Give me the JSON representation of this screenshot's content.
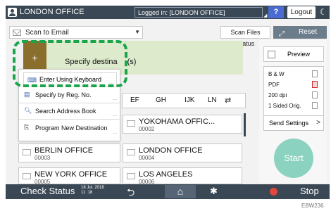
{
  "topbar": {
    "title": "LONDON OFFICE",
    "login_status": "Logged in: [LONDON OFFICE]",
    "help_label": "?",
    "logout_label": "Logout"
  },
  "toolbar": {
    "mode_label": "Scan to Email",
    "scan_files_status_label": "Scan Files Status",
    "reset_label": "Reset"
  },
  "destination": {
    "plus_label": "+",
    "specify_label": "Specify destina",
    "specify_suffix": "(s)"
  },
  "popup": {
    "items": [
      {
        "label": "Enter Using Keyboard",
        "icon": "keyboard-icon"
      },
      {
        "label": "Specify by Reg. No.",
        "icon": "number-icon"
      },
      {
        "label": "Search Address Book",
        "icon": "search-icon"
      },
      {
        "label": "Program New Destination",
        "icon": "program-icon"
      }
    ],
    "more": "..."
  },
  "tabs": [
    "EF",
    "GH",
    "IJK",
    "LN"
  ],
  "address_list": [
    {
      "name": "YOKOHAMA OFFIC...",
      "number": "00002"
    },
    {
      "name": "BERLIN OFFICE",
      "number": "00003"
    },
    {
      "name": "LONDON OFFICE",
      "number": "00004"
    },
    {
      "name": "NEW YORK OFFICE",
      "number": "00005"
    },
    {
      "name": "LOS ANGELES",
      "number": "00006"
    }
  ],
  "side_panel": {
    "preview_label": "Preview",
    "settings": [
      "B & W",
      "PDF",
      "200 dpi",
      "1 Sided Orig."
    ],
    "send_settings_label": "Send Settings",
    "start_label": "Start"
  },
  "bottombar": {
    "check_status_label": "Check Status",
    "date": "18 Jul. 2018",
    "time": "11 :18",
    "stop_label": "Stop"
  },
  "figure_code": "EBW236",
  "colors": {
    "bar": "#3a4754",
    "highlight": "#1aa54b",
    "destination_bg": "#ddeacc",
    "plus_bg": "#8a6f2c",
    "start": "#8bd3c0",
    "stop": "#e0473f",
    "help": "#4a6bd2"
  }
}
